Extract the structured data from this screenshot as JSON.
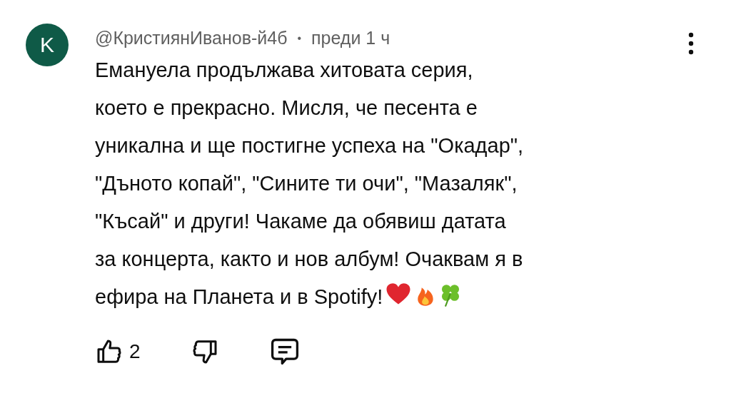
{
  "comment": {
    "avatar_letter": "K",
    "author": "@КристиянИванов-й4б",
    "separator": "•",
    "time": "преди 1 ч",
    "text_lines": [
      "Емануела продължава хитовата серия,",
      "което е прекрасно. Мисля, че песента е",
      "уникална и ще постигне успеха на \"Окадар\",",
      "\"Дъното копай\", \"Сините ти очи\", \"Мазаляк\",",
      "\"Късай\" и други! Чакаме да обявиш датата",
      "за концерта, както и нов албум! Очаквам я в",
      "ефира на Планета и в Spotify!"
    ],
    "like_count": "2"
  }
}
